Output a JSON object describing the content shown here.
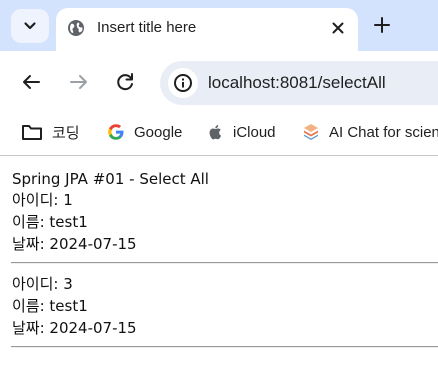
{
  "tab": {
    "title": "Insert title here"
  },
  "omnibox": {
    "url": "localhost:8081/selectAll"
  },
  "bookmarks": [
    {
      "label": "코딩",
      "icon": "folder-icon"
    },
    {
      "label": "Google",
      "icon": "google-icon"
    },
    {
      "label": "iCloud",
      "icon": "apple-icon"
    },
    {
      "label": "AI Chat for scien",
      "icon": "ai-chat-icon"
    }
  ],
  "page": {
    "heading": "Spring JPA #01 - Select All",
    "records": [
      {
        "id_line": "아이디: 1",
        "name_line": "이름: test1",
        "date_line": "날짜: 2024-07-15"
      },
      {
        "id_line": "아이디: 3",
        "name_line": "이름: test1",
        "date_line": "날짜: 2024-07-15"
      }
    ]
  },
  "colors": {
    "tabstrip": "#d3e3fd",
    "omnibox": "#e9eef6",
    "google_blue": "#4285f4",
    "google_red": "#ea4335",
    "google_yellow": "#fbbc05",
    "google_green": "#34a853"
  }
}
